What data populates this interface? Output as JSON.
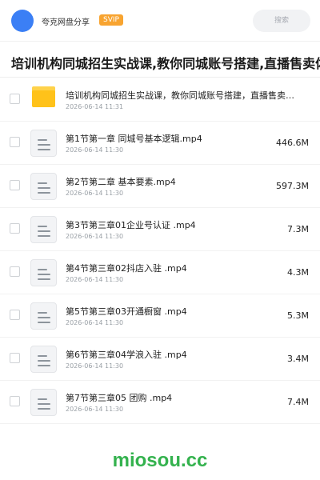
{
  "header": {
    "sharer": "夸克网盘分享",
    "badge": "SVIP",
    "search_placeholder": "搜索"
  },
  "page": {
    "title": "培训机构同城招生实战课,教你同城账号搭建,直播售卖体验课"
  },
  "files": [
    {
      "type": "folder",
      "name": "培训机构同城招生实战课，教你同城账号搭建，直播售卖体验课",
      "date": "2026-06-14 11:31",
      "size": ""
    },
    {
      "type": "file",
      "name": "第1节第一章 同城号基本逻辑.mp4",
      "date": "2026-06-14 11:30",
      "size": "446.6M"
    },
    {
      "type": "file",
      "name": "第2节第二章 基本要素.mp4",
      "date": "2026-06-14 11:30",
      "size": "597.3M"
    },
    {
      "type": "file",
      "name": "第3节第三章01企业号认证 .mp4",
      "date": "2026-06-14 11:30",
      "size": "7.3M"
    },
    {
      "type": "file",
      "name": "第4节第三章02抖店入驻 .mp4",
      "date": "2026-06-14 11:30",
      "size": "4.3M"
    },
    {
      "type": "file",
      "name": "第5节第三章03开通橱窗 .mp4",
      "date": "2026-06-14 11:30",
      "size": "5.3M"
    },
    {
      "type": "file",
      "name": "第6节第三章04学浪入驻 .mp4",
      "date": "2026-06-14 11:30",
      "size": "3.4M"
    },
    {
      "type": "file",
      "name": "第7节第三章05 团购 .mp4",
      "date": "2026-06-14 11:30",
      "size": "7.4M"
    }
  ],
  "watermark": "miosou.cc",
  "colors": {
    "avatar": "#3b7ff5",
    "svip_badge": "#f8a430",
    "folder": "#ffc21a",
    "watermark": "#34b24e"
  }
}
